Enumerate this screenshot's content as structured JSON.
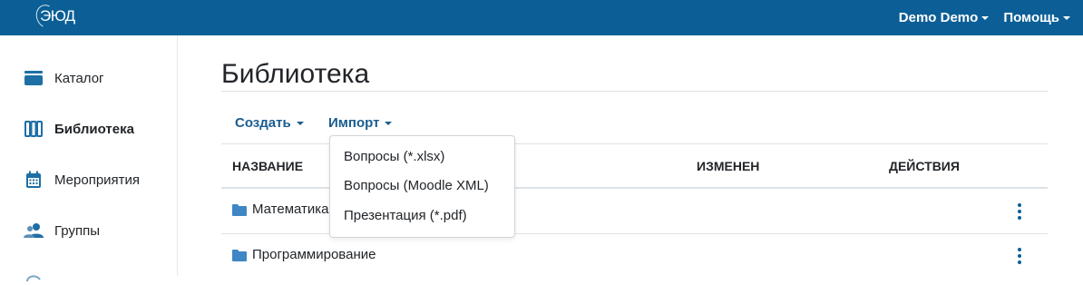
{
  "app": {
    "logo_text": "ЭЮД"
  },
  "topnav": {
    "user_label": "Demo Demo",
    "help_label": "Помощь"
  },
  "sidebar": {
    "items": [
      {
        "label": "Каталог",
        "icon": "catalog-icon"
      },
      {
        "label": "Библиотека",
        "icon": "library-icon",
        "active": true
      },
      {
        "label": "Мероприятия",
        "icon": "calendar-icon"
      },
      {
        "label": "Группы",
        "icon": "users-icon"
      }
    ]
  },
  "main": {
    "title": "Библиотека",
    "toolbar": {
      "create_label": "Создать",
      "import_label": "Импорт"
    },
    "table": {
      "headers": {
        "name": "НАЗВАНИЕ",
        "modified": "ИЗМЕНЕН",
        "actions": "ДЕЙСТВИЯ"
      },
      "rows": [
        {
          "name": "Математика",
          "icon": "folder-icon"
        },
        {
          "name": "Программирование",
          "icon": "folder-icon"
        }
      ]
    },
    "import_menu": {
      "items": [
        "Вопросы (*.xlsx)",
        "Вопросы (Moodle XML)",
        "Презентация (*.pdf)"
      ]
    }
  },
  "colors": {
    "header_bg": "#0b5f96",
    "accent": "#1a5d8f",
    "folder": "#3f87c4"
  }
}
